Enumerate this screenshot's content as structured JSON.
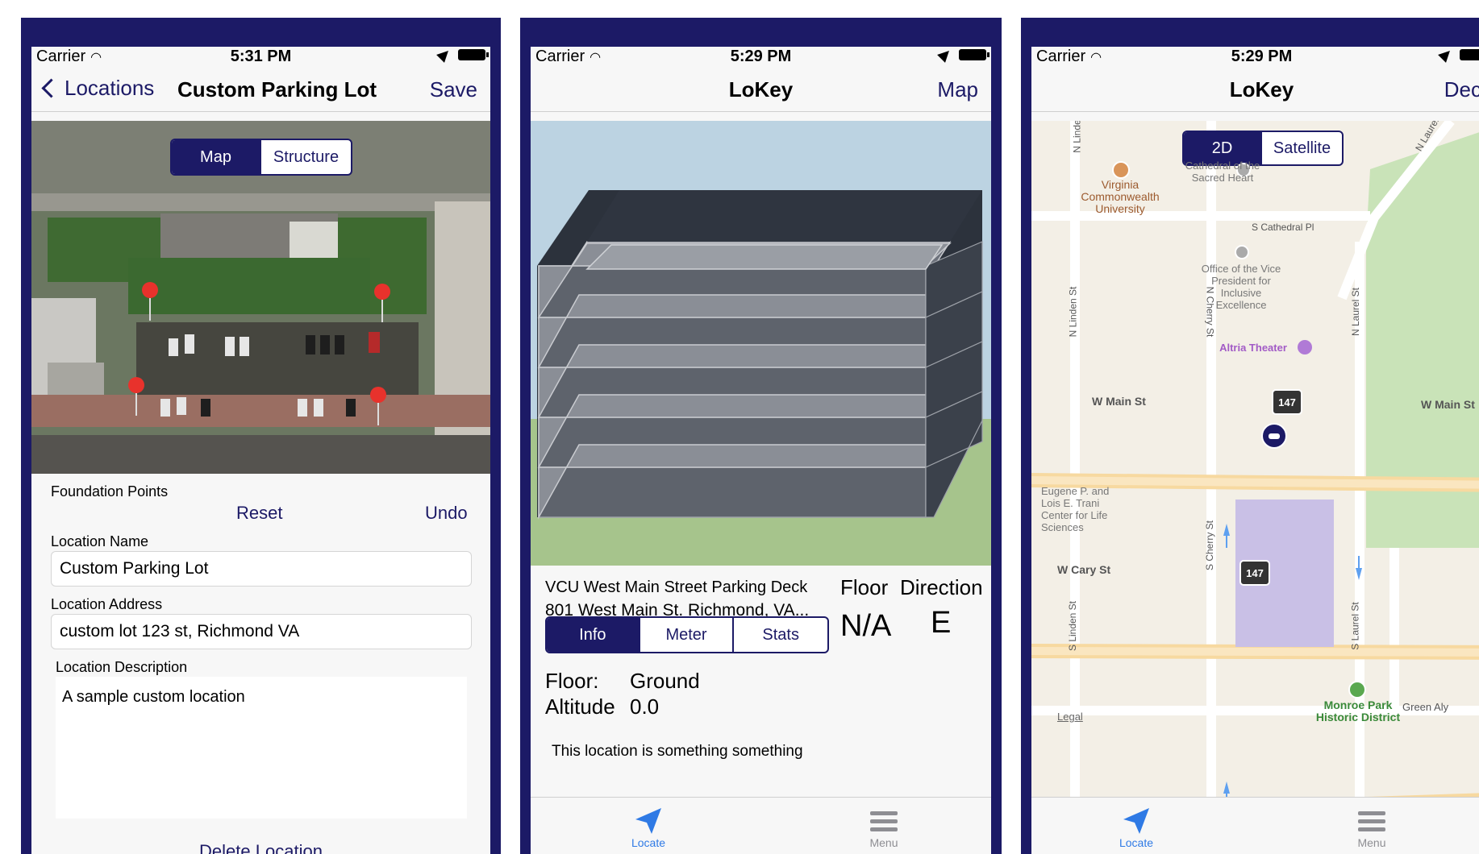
{
  "status": {
    "carrier": "Carrier",
    "time_1": "5:31 PM",
    "time_2": "5:29 PM",
    "time_3": "5:29 PM"
  },
  "screen1": {
    "back_label": "Locations",
    "title": "Custom Parking Lot",
    "save_label": "Save",
    "segment": [
      "Map",
      "Structure"
    ],
    "selected_segment": "Map",
    "foundation_label": "Foundation Points",
    "reset_label": "Reset",
    "undo_label": "Undo",
    "name_label": "Location Name",
    "name_value": "Custom Parking Lot",
    "address_label": "Location Address",
    "address_value": "custom lot 123 st, Richmond VA",
    "description_label": "Location Description",
    "description_value": "A sample custom location",
    "delete_label": "Delete Location"
  },
  "screen2": {
    "title": "LoKey",
    "map_label": "Map",
    "deck_name": "VCU West Main Street Parking Deck",
    "deck_address": "801 West Main St. Richmond, VA...",
    "floor_header": "Floor",
    "direction_header": "Direction",
    "floor_value": "N/A",
    "direction_value": "E",
    "segment": [
      "Info",
      "Meter",
      "Stats"
    ],
    "selected_segment": "Info",
    "floor_label": "Floor:",
    "floor_detail": "Ground",
    "altitude_label": "Altitude",
    "altitude_value": "0.0",
    "description": "This location is something something",
    "tabs": [
      "Locate",
      "Menu"
    ]
  },
  "screen3": {
    "title": "LoKey",
    "deck_label": "Deck",
    "segment": [
      "2D",
      "Satellite"
    ],
    "selected_segment": "2D",
    "streets": [
      "W Main St",
      "W Main St",
      "W Cary St",
      "S Cathedral Pl",
      "N Linden St",
      "N Cherry St",
      "N Laurel St",
      "S Laurel St",
      "S Cherry St",
      "S Linden St",
      "Green Aly",
      "N Linde",
      "N Laurel"
    ],
    "highway": "147",
    "pois": [
      "Virginia Commonwealth University",
      "Cathedral of the Sacred Heart",
      "Office of the Vice President for Inclusive Excellence",
      "Altria Theater",
      "Eugene P. and Lois E. Trani Center for Life Sciences",
      "Monroe Park Historic District"
    ],
    "legal": "Legal",
    "tabs": [
      "Locate",
      "Menu"
    ]
  },
  "colors": {
    "brand": "#1c1a66",
    "tab_active": "#2f7ae5",
    "tab_inactive": "#8e8e93",
    "parking_area": "#c9c0e6"
  },
  "icons": [
    "wifi-icon",
    "location-arrow-icon",
    "battery-icon",
    "back-chevron-icon",
    "map-pin-icon",
    "car-marker-icon",
    "locate-arrow-icon",
    "menu-icon",
    "poi-icon",
    "park-icon"
  ]
}
